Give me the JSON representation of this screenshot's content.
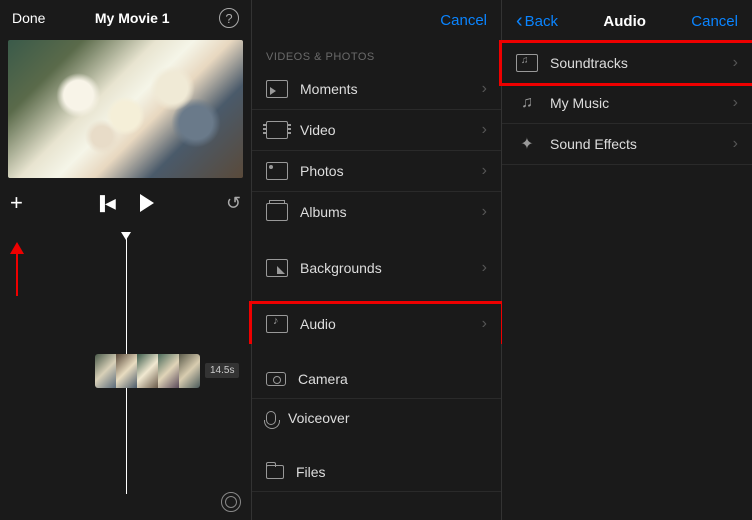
{
  "panel1": {
    "done": "Done",
    "title": "My Movie 1",
    "clip_duration": "14.5s"
  },
  "panel2": {
    "cancel": "Cancel",
    "section": "VIDEOS & PHOTOS",
    "items": {
      "moments": "Moments",
      "video": "Video",
      "photos": "Photos",
      "albums": "Albums",
      "backgrounds": "Backgrounds",
      "audio": "Audio",
      "camera": "Camera",
      "voiceover": "Voiceover",
      "files": "Files"
    }
  },
  "panel3": {
    "back": "Back",
    "title": "Audio",
    "cancel": "Cancel",
    "items": {
      "soundtracks": "Soundtracks",
      "mymusic": "My Music",
      "soundfx": "Sound Effects"
    }
  }
}
